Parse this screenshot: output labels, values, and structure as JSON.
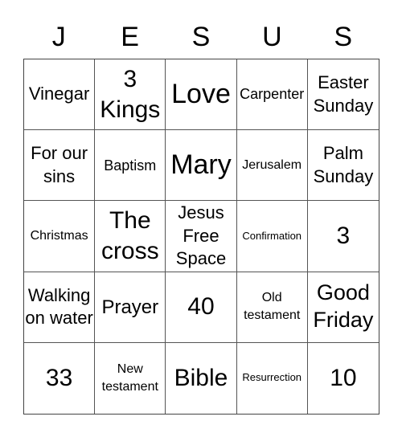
{
  "title_letters": [
    "J",
    "E",
    "S",
    "U",
    "S"
  ],
  "card": [
    [
      "Vinegar",
      "3 Kings",
      "Love",
      "Carpenter",
      "Easter Sunday"
    ],
    [
      "For our sins",
      "Baptism",
      "Mary",
      "Jerusalem",
      "Palm Sunday"
    ],
    [
      "Christmas",
      "The cross",
      "Jesus Free Space",
      "Confirmation",
      "3"
    ],
    [
      "Walking on water",
      "Prayer",
      "40",
      "Old testament",
      "Good Friday"
    ],
    [
      "33",
      "New testament",
      "Bible",
      "Resurrection",
      "10"
    ]
  ],
  "free_space": {
    "row": 2,
    "col": 2
  }
}
